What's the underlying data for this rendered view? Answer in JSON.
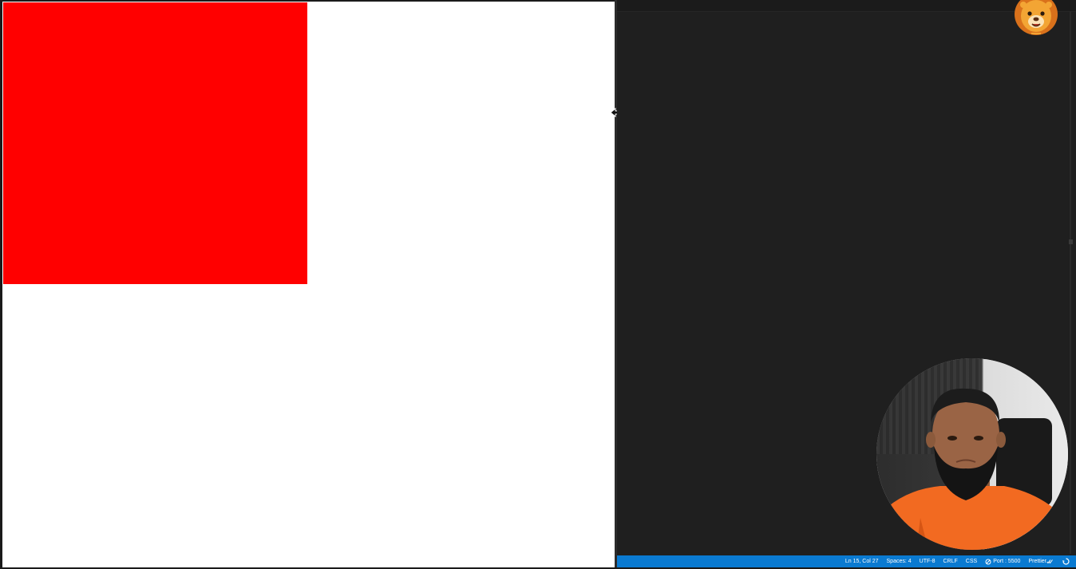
{
  "colors": {
    "preview_background": "#ffffff",
    "red_box": "#ff0000",
    "editor_background": "#1f1f1f",
    "statusbar_background": "#0a7ad1",
    "statusbar_text": "#ffffff"
  },
  "preview": {
    "box_icon": "red-square"
  },
  "cursor": {
    "icon": "horizontal-resize-cursor"
  },
  "logo": {
    "icon": "lion-mascot-logo"
  },
  "webcam": {
    "icon": "presenter-webcam-overlay"
  },
  "statusbar": {
    "position": "Ln 15, Col 27",
    "spaces": "Spaces: 4",
    "encoding": "UTF-8",
    "line_ending": "CRLF",
    "language": "CSS",
    "port": "Port : 5500",
    "formatter": "Prettier",
    "formatter_icon": "double-check-icon",
    "port_icon": "port-broadcast-icon",
    "notification_icon": "bell-sync-icon"
  }
}
